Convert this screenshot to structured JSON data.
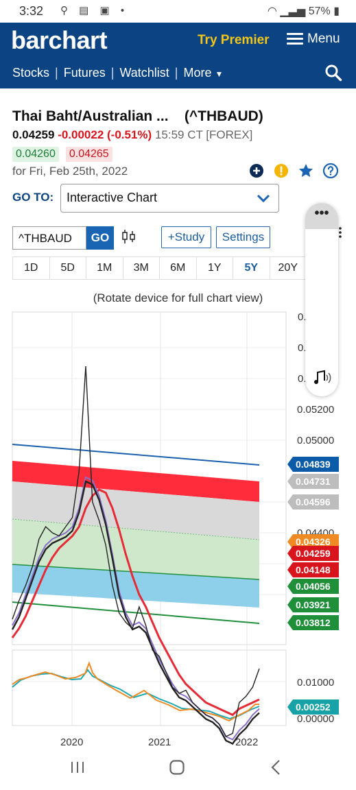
{
  "status_bar": {
    "time": "3:32",
    "left_icons": "⚲ ▤ ▣ •",
    "battery": "57%"
  },
  "header": {
    "logo": "barchart",
    "try_premier": "Try Premier",
    "menu_label": "Menu",
    "nav": [
      "Stocks",
      "Futures",
      "Watchlist",
      "More"
    ]
  },
  "quote": {
    "name": "Thai Baht/Australian ...",
    "symbol": "(^THBAUD)",
    "last": "0.04259",
    "change": "-0.00022 (-0.51%)",
    "time": "15:59 CT [FOREX]",
    "bid": "0.04260",
    "ask": "0.04265",
    "for_date": "for Fri, Feb 25th, 2022"
  },
  "goto": {
    "label": "GO TO:",
    "selected": "Interactive Chart"
  },
  "toolbar": {
    "symbol_value": "^THBAUD",
    "go_label": "GO",
    "study_label": "+Study",
    "settings_label": "Settings"
  },
  "periods": [
    "1D",
    "5D",
    "1M",
    "3M",
    "6M",
    "1Y",
    "5Y",
    "20Y"
  ],
  "active_period": "5Y",
  "rotate_hint": "(Rotate device for full chart view)",
  "pill": {
    "dots": "•••"
  },
  "colors": {
    "header_bg": "#0b4383",
    "accent_yellow": "#f5c518",
    "down_red": "#d8141c",
    "up_green": "#1c7c36",
    "link_blue": "#1a5c9e"
  },
  "chart_data": {
    "type": "line",
    "x_labels": [
      "2020",
      "2021",
      "2022"
    ],
    "price_axis_ticks": [
      "0.05200",
      "0.05000",
      "0.04400"
    ],
    "price_labels": [
      {
        "value": "0.04839",
        "color": "#0b5ba8"
      },
      {
        "value": "0.04731",
        "color": "#bdbdbd"
      },
      {
        "value": "0.04596",
        "color": "#bdbdbd"
      },
      {
        "value": "0.04326",
        "color": "#f08a24"
      },
      {
        "value": "0.04259",
        "color": "#d8141c"
      },
      {
        "value": "0.04148",
        "color": "#d8141c"
      },
      {
        "value": "0.04056",
        "color": "#1f8f3a"
      },
      {
        "value": "0.03921",
        "color": "#1f8f3a"
      },
      {
        "value": "0.03812",
        "color": "#1f8f3a"
      }
    ],
    "osc_axis_ticks": [
      "0.01000",
      "0.00000"
    ],
    "osc_label": {
      "value": "0.00252",
      "color": "#17a2a8"
    },
    "series": [
      {
        "values": [
          0.0442,
          0.0448,
          0.0453,
          0.0459,
          0.0468,
          0.0472,
          0.047,
          0.0469,
          0.0472,
          0.0475,
          0.049,
          0.0524,
          0.048,
          0.0474,
          0.0466,
          0.0453,
          0.0444,
          0.0441,
          0.0439,
          0.0446,
          0.044,
          0.0432,
          0.043,
          0.0425,
          0.042,
          0.0418,
          0.0419,
          0.0415,
          0.0413,
          0.0411,
          0.041,
          0.0408,
          0.0404,
          0.0405,
          0.0415,
          0.0417,
          0.042,
          0.0426
        ]
      },
      {
        "values": [
          0.044,
          0.0444,
          0.045,
          0.0456,
          0.0462,
          0.0466,
          0.0468,
          0.0469,
          0.047,
          0.0472,
          0.0478,
          0.0488,
          0.0487,
          0.0482,
          0.0474,
          0.0463,
          0.0451,
          0.0444,
          0.044,
          0.0441,
          0.0439,
          0.0434,
          0.0429,
          0.0425,
          0.0421,
          0.0418,
          0.0417,
          0.0415,
          0.0413,
          0.0411,
          0.041,
          0.0408,
          0.0404,
          0.0403,
          0.0406,
          0.0408,
          0.0411,
          0.0413
        ]
      },
      {
        "values": [
          0.0436,
          0.0439,
          0.0443,
          0.0448,
          0.0453,
          0.0458,
          0.0462,
          0.0465,
          0.0467,
          0.0469,
          0.0472,
          0.0478,
          0.0482,
          0.0484,
          0.0483,
          0.0478,
          0.0471,
          0.0463,
          0.0456,
          0.045,
          0.0446,
          0.0441,
          0.0436,
          0.0432,
          0.0428,
          0.0424,
          0.0421,
          0.0419,
          0.0417,
          0.0415,
          0.0414,
          0.0413,
          0.0412,
          0.0411,
          0.0413,
          0.0414,
          0.0415,
          0.0416
        ]
      }
    ]
  }
}
